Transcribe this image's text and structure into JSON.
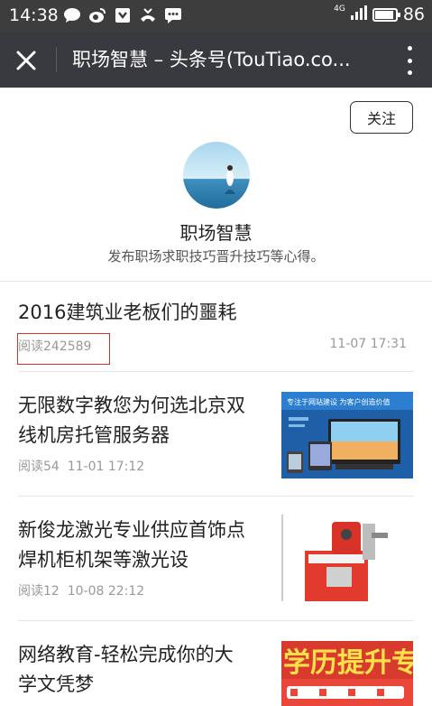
{
  "status_bar": {
    "time": "14:38",
    "network": "4G",
    "battery": "86",
    "battery_level": 0.86
  },
  "title_bar": {
    "title": "职场智慧 – 头条号(TouTiao.co..."
  },
  "profile": {
    "follow_label": "关注",
    "name": "职场智慧",
    "description": "发布职场求职技巧晋升技巧等心得。"
  },
  "articles": [
    {
      "title": "2016建筑业老板们的噩耗",
      "reads": "阅读242589",
      "time": "11-07 17:31"
    },
    {
      "title_line1": "无限数字教您为何选北京双",
      "title_line2": "线机房托管服务器",
      "reads": "阅读54",
      "time": "11-01 17:12"
    },
    {
      "title_line1": "新俊龙激光专业供应首饰点",
      "title_line2": "焊机柜机架等激光设",
      "reads": "阅读12",
      "time": "10-08 22:12"
    },
    {
      "title_line1": "网络教育-轻松完成你的大",
      "title_line2": "学文凭梦"
    }
  ],
  "thumb_texts": {
    "web_banner": "专注于网站建设 为客户创造价值",
    "edu_banner": "学历提升专"
  }
}
